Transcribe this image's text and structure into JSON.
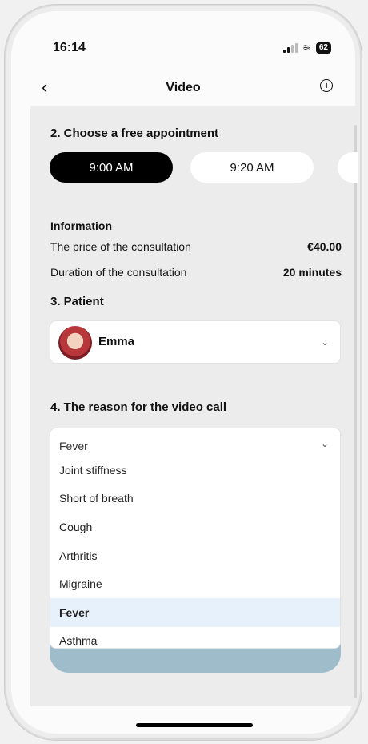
{
  "status": {
    "time": "16:14",
    "battery": "62"
  },
  "nav": {
    "title": "Video",
    "back_icon": "chevron-left-icon",
    "info_icon": "info-circle-icon"
  },
  "appointment": {
    "title": "2. Choose a free appointment",
    "slots": [
      "9:00 AM",
      "9:20 AM"
    ],
    "selected": "9:00 AM"
  },
  "information": {
    "title": "Information",
    "rows": [
      {
        "label": "The price of the consultation",
        "value": "€40.00"
      },
      {
        "label": "Duration of the consultation",
        "value": "20 minutes"
      }
    ]
  },
  "patient": {
    "title": "3. Patient",
    "name": "Emma"
  },
  "reason": {
    "title": "4. The reason for the video call",
    "selected": "Fever",
    "options": [
      "Joint stiffness",
      "Short of breath",
      "Cough",
      "Arthritis",
      "Migraine",
      "Fever",
      "Asthma"
    ]
  },
  "colors": {
    "accent": "#000000",
    "selected_option": "#e7f1fc",
    "continue_button": "#9fbccb"
  }
}
